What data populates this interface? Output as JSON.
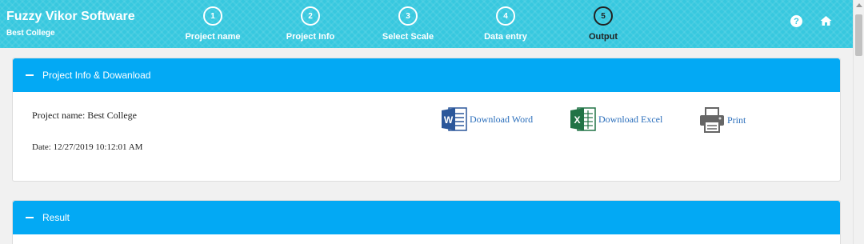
{
  "header": {
    "app_title": "Fuzzy Vikor Software",
    "project_subtitle": "Best College",
    "steps": [
      {
        "number": "1",
        "label": "Project name"
      },
      {
        "number": "2",
        "label": "Project Info"
      },
      {
        "number": "3",
        "label": "Select Scale"
      },
      {
        "number": "4",
        "label": "Data entry"
      },
      {
        "number": "5",
        "label": "Output"
      }
    ],
    "active_step": "5",
    "help_icon_glyph": "?",
    "colors": {
      "header_bg": "#37c8df",
      "panel_header": "#03a9f4"
    }
  },
  "panel_info": {
    "title": "Project Info & Dowanload",
    "project_name": "Project name: Best College",
    "date": "Date: 12/27/2019 10:12:01 AM",
    "download_word": "Download Word",
    "download_excel": "Download Excel",
    "print": "Print"
  },
  "panel_result": {
    "title": "Result"
  }
}
